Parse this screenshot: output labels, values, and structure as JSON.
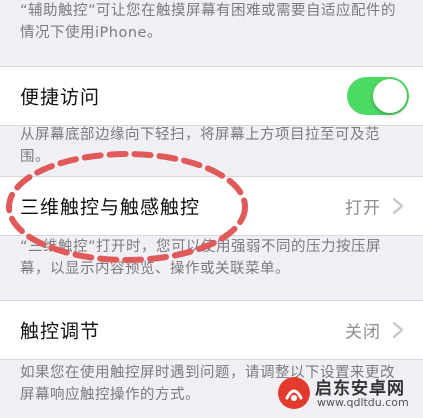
{
  "top_footnote": "“辅助触控”可让您在触摸屏幕有困难或需要自适应配件的情况下使用iPhone。",
  "accessibility_shortcut": {
    "label": "便捷访问",
    "toggle_on": true,
    "toggle_color": "#4cd964",
    "footnote": "从屏幕底部边缘向下轻扫，将屏幕上方项目拉至可及范围。"
  },
  "touch_3d": {
    "label": "三维触控与触感触控",
    "value": "打开",
    "footnote": "“三维触控”打开时，您可以使用强弱不同的压力按压屏幕，以显示内容预览、操作或关联菜单。"
  },
  "touch_accommodations": {
    "label": "触控调节",
    "value": "关闭",
    "footnote": "如果您在使用触控屏时遇到问题，请调整以下设置来更改屏幕响应触控操作的方式。"
  },
  "annotation_color": "#e05a5a",
  "watermark": {
    "name": "启东安卓网",
    "url": "www.qdltdu.com"
  }
}
